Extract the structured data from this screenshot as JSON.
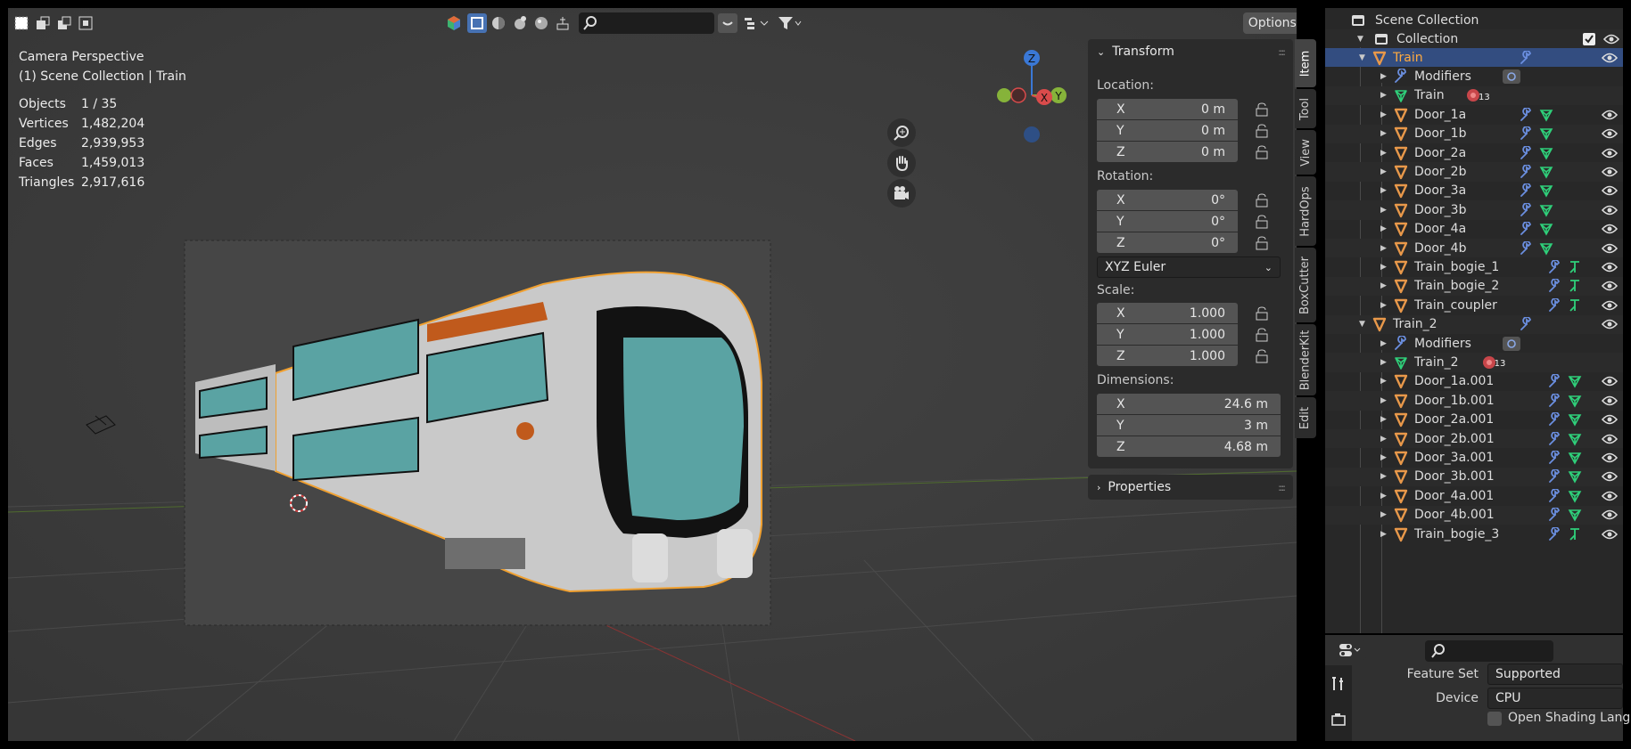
{
  "viewport": {
    "options_label": "Options",
    "overlay_title": "Camera Perspective",
    "overlay_subtitle": "(1) Scene Collection | Train",
    "stats": [
      {
        "label": "Objects",
        "value": "1 / 35"
      },
      {
        "label": "Vertices",
        "value": "1,482,204"
      },
      {
        "label": "Edges",
        "value": "2,939,953"
      },
      {
        "label": "Faces",
        "value": "1,459,013"
      },
      {
        "label": "Triangles",
        "value": "2,917,616"
      }
    ],
    "gizmo": {
      "z": "Z",
      "x": "X",
      "y": "Y"
    },
    "header_icons": [
      "select-box-icon",
      "select-extend-icon",
      "select-subtract-icon",
      "select-intersect-icon",
      "scene-icon",
      "solid-shading-icon",
      "material-shading-icon",
      "rendered-shading-icon",
      "lookdev-icon",
      "overlay-icon",
      "search-icon",
      "filter-icon"
    ]
  },
  "transform_panel": {
    "title": "Transform",
    "location_label": "Location:",
    "location": [
      {
        "axis": "X",
        "value": "0 m"
      },
      {
        "axis": "Y",
        "value": "0 m"
      },
      {
        "axis": "Z",
        "value": "0 m"
      }
    ],
    "rotation_label": "Rotation:",
    "rotation": [
      {
        "axis": "X",
        "value": "0°"
      },
      {
        "axis": "Y",
        "value": "0°"
      },
      {
        "axis": "Z",
        "value": "0°"
      }
    ],
    "rotation_mode": "XYZ Euler",
    "scale_label": "Scale:",
    "scale": [
      {
        "axis": "X",
        "value": "1.000"
      },
      {
        "axis": "Y",
        "value": "1.000"
      },
      {
        "axis": "Z",
        "value": "1.000"
      }
    ],
    "dimensions_label": "Dimensions:",
    "dimensions": [
      {
        "axis": "X",
        "value": "24.6 m"
      },
      {
        "axis": "Y",
        "value": "3 m"
      },
      {
        "axis": "Z",
        "value": "4.68 m"
      }
    ]
  },
  "properties_panel": {
    "title": "Properties"
  },
  "side_tabs": [
    "Item",
    "Tool",
    "View",
    "HardOps",
    "BoxCutter",
    "BlenderKit",
    "Edit"
  ],
  "outliner": {
    "root": "Scene Collection",
    "collection": "Collection",
    "rows": [
      {
        "name": "Train",
        "level": 1,
        "kind": "object",
        "expanded": true,
        "selected": true
      },
      {
        "name": "Modifiers",
        "level": 2,
        "kind": "modifiers"
      },
      {
        "name": "Train",
        "level": 2,
        "kind": "mesh",
        "badge": "13"
      },
      {
        "name": "Door_1a",
        "level": 2,
        "kind": "object"
      },
      {
        "name": "Door_1b",
        "level": 2,
        "kind": "object"
      },
      {
        "name": "Door_2a",
        "level": 2,
        "kind": "object"
      },
      {
        "name": "Door_2b",
        "level": 2,
        "kind": "object"
      },
      {
        "name": "Door_3a",
        "level": 2,
        "kind": "object"
      },
      {
        "name": "Door_3b",
        "level": 2,
        "kind": "object"
      },
      {
        "name": "Door_4a",
        "level": 2,
        "kind": "object"
      },
      {
        "name": "Door_4b",
        "level": 2,
        "kind": "object"
      },
      {
        "name": "Train_bogie_1",
        "level": 2,
        "kind": "object"
      },
      {
        "name": "Train_bogie_2",
        "level": 2,
        "kind": "object"
      },
      {
        "name": "Train_coupler",
        "level": 2,
        "kind": "object"
      },
      {
        "name": "Train_2",
        "level": 1,
        "kind": "object",
        "expanded": true
      },
      {
        "name": "Modifiers",
        "level": 2,
        "kind": "modifiers"
      },
      {
        "name": "Train_2",
        "level": 2,
        "kind": "mesh",
        "badge": "13"
      },
      {
        "name": "Door_1a.001",
        "level": 2,
        "kind": "object"
      },
      {
        "name": "Door_1b.001",
        "level": 2,
        "kind": "object"
      },
      {
        "name": "Door_2a.001",
        "level": 2,
        "kind": "object"
      },
      {
        "name": "Door_2b.001",
        "level": 2,
        "kind": "object"
      },
      {
        "name": "Door_3a.001",
        "level": 2,
        "kind": "object"
      },
      {
        "name": "Door_3b.001",
        "level": 2,
        "kind": "object"
      },
      {
        "name": "Door_4a.001",
        "level": 2,
        "kind": "object"
      },
      {
        "name": "Door_4b.001",
        "level": 2,
        "kind": "object"
      },
      {
        "name": "Train_bogie_3",
        "level": 2,
        "kind": "object"
      }
    ]
  },
  "render_props": {
    "feature_set_label": "Feature Set",
    "feature_set_value": "Supported",
    "device_label": "Device",
    "device_value": "CPU",
    "osl_label": "Open Shading Langua"
  },
  "colors": {
    "accent": "#334d80",
    "selection_outline": "#f0a030",
    "object_icon": "#e8984a",
    "mesh_icon": "#2fd07a",
    "modifier_icon": "#6b8fe0"
  }
}
